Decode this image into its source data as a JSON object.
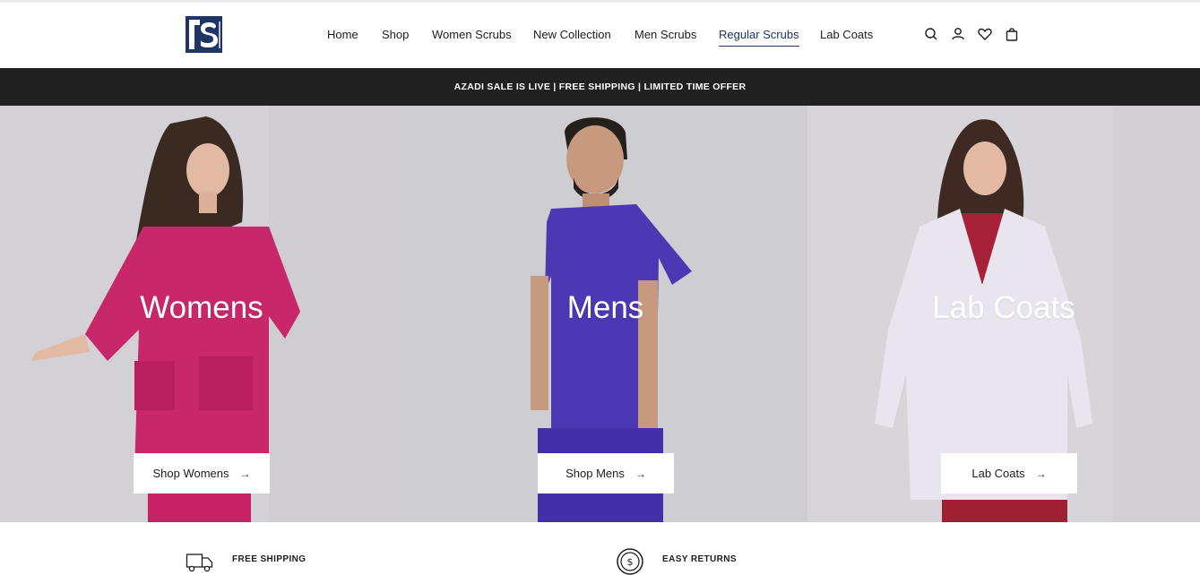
{
  "announcement": "AZADI SALE IS LIVE | FREE SHIPPING | LIMITED TIME OFFER",
  "nav": {
    "items": [
      {
        "label": "Home"
      },
      {
        "label": "Shop"
      },
      {
        "label": "Women Scrubs"
      },
      {
        "label": "New Collection"
      },
      {
        "label": "Men Scrubs"
      },
      {
        "label": "Regular Scrubs",
        "active": true
      },
      {
        "label": "Lab Coats"
      }
    ]
  },
  "header_icons": [
    "search-icon",
    "account-icon",
    "wishlist-heart-icon",
    "cart-bag-icon"
  ],
  "brand": {
    "primary_color": "#1e3565",
    "logo_letter": "S"
  },
  "hero": {
    "panels": [
      {
        "title": "Womens",
        "button": "Shop Womens",
        "arrow": "→",
        "garment_color": "#c8276a"
      },
      {
        "title": "Mens",
        "button": "Shop Mens",
        "arrow": "→",
        "garment_color": "#4b38b2"
      },
      {
        "title": "Lab Coats",
        "button": "Lab Coats",
        "arrow": "→",
        "garment_color": "#e8e5ee"
      }
    ]
  },
  "features": [
    {
      "label": "FREE SHIPPING",
      "icon": "delivery-truck-icon"
    },
    {
      "label": "EASY RETURNS",
      "icon": "dollar-coin-icon"
    }
  ],
  "colors": {
    "announcement_bg": "#212121",
    "hero_bg": "#cfcdd2"
  }
}
